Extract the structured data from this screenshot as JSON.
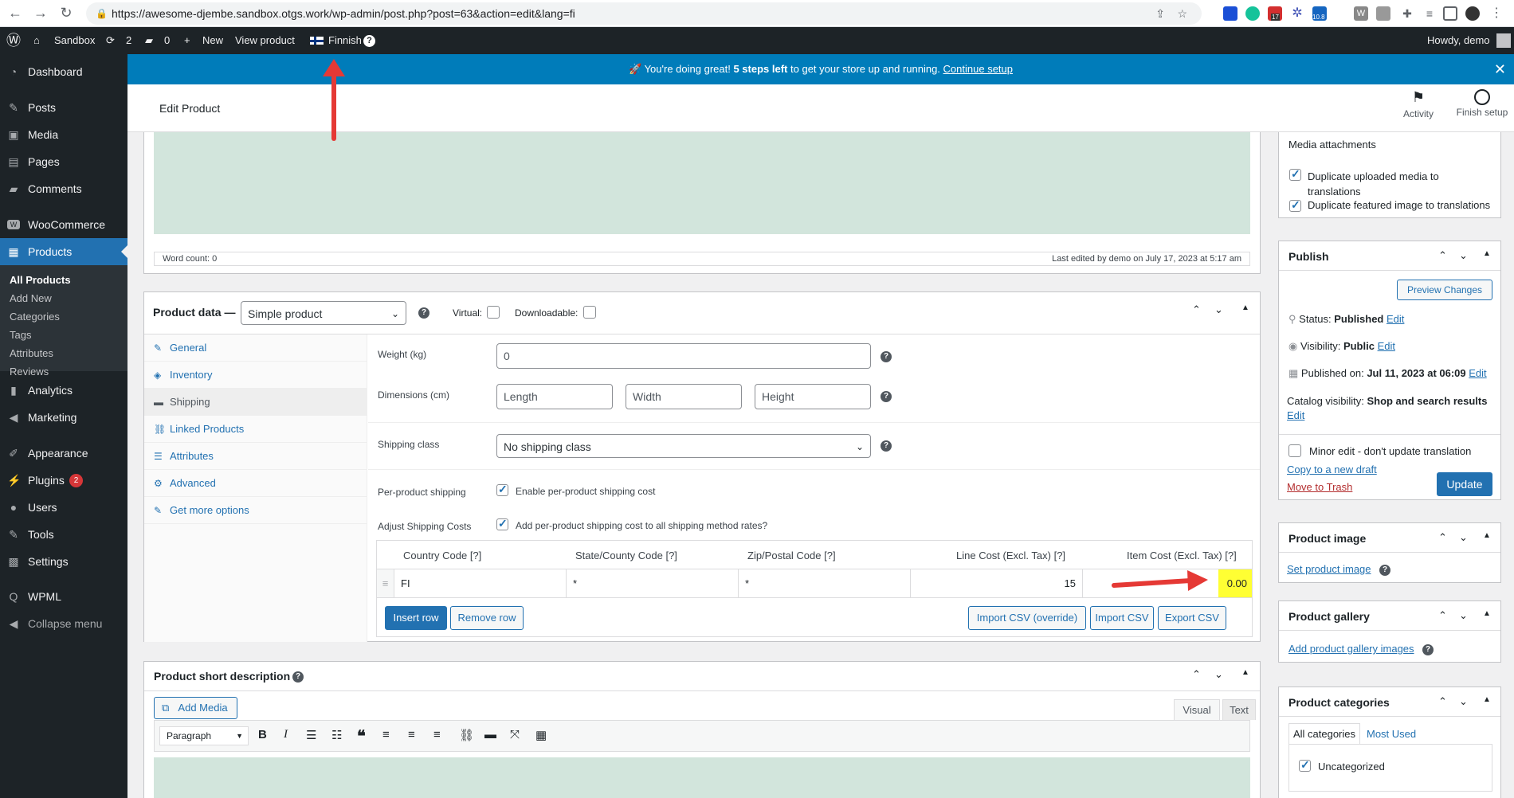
{
  "browser": {
    "url": "https://awesome-djembe.sandbox.otgs.work/wp-admin/post.php?post=63&action=edit&lang=fi",
    "ext_badge_1": "17",
    "ext_badge_2": "10.8"
  },
  "adminbar": {
    "site": "Sandbox",
    "updates_count": "2",
    "comments_count": "0",
    "new_label": "New",
    "view_product": "View product",
    "language": "Finnish",
    "howdy": "Howdy, demo"
  },
  "sidebar": {
    "items": [
      {
        "label": "Dashboard",
        "icon": "dashboard-icon"
      },
      {
        "label": "Posts",
        "icon": "pin-icon"
      },
      {
        "label": "Media",
        "icon": "media-icon"
      },
      {
        "label": "Pages",
        "icon": "pages-icon"
      },
      {
        "label": "Comments",
        "icon": "comment-icon"
      },
      {
        "label": "WooCommerce",
        "icon": "woo-icon"
      },
      {
        "label": "Products",
        "icon": "products-icon"
      },
      {
        "label": "Analytics",
        "icon": "chart-icon"
      },
      {
        "label": "Marketing",
        "icon": "megaphone-icon"
      },
      {
        "label": "Appearance",
        "icon": "brush-icon"
      },
      {
        "label": "Plugins",
        "icon": "plugin-icon",
        "badge": "2"
      },
      {
        "label": "Users",
        "icon": "user-icon"
      },
      {
        "label": "Tools",
        "icon": "wrench-icon"
      },
      {
        "label": "Settings",
        "icon": "settings-icon"
      },
      {
        "label": "WPML",
        "icon": "wpml-icon"
      },
      {
        "label": "Collapse menu",
        "icon": "collapse-icon"
      }
    ],
    "submenu": [
      "All Products",
      "Add New",
      "Categories",
      "Tags",
      "Attributes",
      "Reviews"
    ]
  },
  "notice": {
    "emoji": "🚀",
    "text_before": "You're doing great!",
    "strong": "5 steps left",
    "text_after": "to get your store up and running.",
    "link": "Continue setup"
  },
  "header": {
    "title": "Edit Product",
    "activity": "Activity",
    "finish_setup": "Finish setup"
  },
  "editor": {
    "word_count": "Word count: 0",
    "last_edited": "Last edited by demo on July 17, 2023 at 5:17 am"
  },
  "product_data": {
    "title": "Product data —",
    "type": "Simple product",
    "virtual": "Virtual:",
    "downloadable": "Downloadable:",
    "tabs": [
      {
        "label": "General",
        "icon": "wrench-icon"
      },
      {
        "label": "Inventory",
        "icon": "tag-icon"
      },
      {
        "label": "Shipping",
        "icon": "truck-icon"
      },
      {
        "label": "Linked Products",
        "icon": "link-icon"
      },
      {
        "label": "Attributes",
        "icon": "list-icon"
      },
      {
        "label": "Advanced",
        "icon": "gear-icon"
      },
      {
        "label": "Get more options",
        "icon": "plugin-icon"
      }
    ],
    "weight_label": "Weight (kg)",
    "weight_value": "0",
    "dimensions_label": "Dimensions (cm)",
    "length_ph": "Length",
    "width_ph": "Width",
    "height_ph": "Height",
    "shipping_class_label": "Shipping class",
    "shipping_class_value": "No shipping class",
    "per_product_label": "Per-product shipping",
    "per_product_cb": "Enable per-product shipping cost",
    "adjust_label": "Adjust Shipping Costs",
    "adjust_cb": "Add per-product shipping cost to all shipping method rates?",
    "table": {
      "headers": [
        "Country Code [?]",
        "State/County Code [?]",
        "Zip/Postal Code [?]",
        "Line Cost (Excl. Tax) [?]",
        "Item Cost (Excl. Tax) [?]"
      ],
      "row": [
        "FI",
        "*",
        "*",
        "15",
        "0.00"
      ]
    },
    "insert_row": "Insert row",
    "remove_row": "Remove row",
    "import_override": "Import CSV (override)",
    "import_csv": "Import CSV",
    "export_csv": "Export CSV"
  },
  "short_desc": {
    "title": "Product short description",
    "add_media": "Add Media",
    "visual": "Visual",
    "text": "Text",
    "paragraph": "Paragraph"
  },
  "right": {
    "media_title": "Media attachments",
    "dup_media": "Duplicate uploaded media to translations",
    "dup_featured": "Duplicate featured image to translations",
    "publish_title": "Publish",
    "preview": "Preview Changes",
    "status_label": "Status:",
    "status_value": "Published",
    "visibility_label": "Visibility:",
    "visibility_value": "Public",
    "published_label": "Published on:",
    "published_value": "Jul 11, 2023 at 06:09",
    "catalog_label": "Catalog visibility:",
    "catalog_value": "Shop and search results",
    "edit": "Edit",
    "minor_edit": "Minor edit - don't update translation",
    "copy_draft": "Copy to a new draft",
    "trash": "Move to Trash",
    "update": "Update",
    "image_title": "Product image",
    "set_image": "Set product image",
    "gallery_title": "Product gallery",
    "add_gallery": "Add product gallery images",
    "categories_title": "Product categories",
    "all_categories": "All categories",
    "most_used": "Most Used",
    "uncategorized": "Uncategorized"
  },
  "colors": {
    "admin_dark": "#1d2327",
    "accent": "#2271b1",
    "notice": "#007cba",
    "highlight": "#ffff33",
    "arrow": "#e53935"
  }
}
